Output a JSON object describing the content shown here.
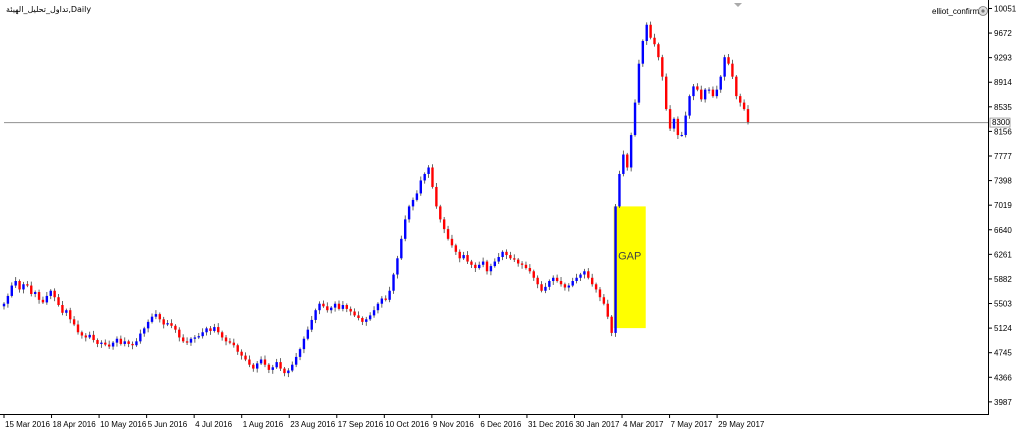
{
  "window": {
    "title": "تداول_تحليل_الهيئة,Daily",
    "indicator_label": "elliot_confirm",
    "indicator_icon": "gear-icon",
    "scroll_marker_icon": "triangle-down-icon"
  },
  "colors": {
    "bull": "#0000ff",
    "bear": "#ff0000",
    "wick": "#404040",
    "axis": "#000000",
    "hline": "#909090",
    "gap_fill": "#ffff00"
  },
  "chart_data": {
    "type": "candlestick",
    "title": "تداول_تحليل_الهيئة,Daily",
    "y_axis_ticks": [
      "10051",
      "9672",
      "9293",
      "8914",
      "8535",
      "8156",
      "7777",
      "7398",
      "7019",
      "6640",
      "6261",
      "5882",
      "5503",
      "5124",
      "4745",
      "4366",
      "3987"
    ],
    "ylim": [
      3800,
      10120
    ],
    "x_axis_ticks": [
      "15 Mar 2016",
      "18 Apr 2016",
      "10 May 2016",
      "5 Jun 2016",
      "4 Jul 2016",
      "1 Aug 2016",
      "23 Aug 2016",
      "17 Sep 2016",
      "10 Oct 2016",
      "9 Nov 2016",
      "6 Dec 2016",
      "31 Dec 2016",
      "30 Jan 2017",
      "4 Mar 2017",
      "7 May 2017",
      "29 May 2017"
    ],
    "horizontal_line": {
      "value": 8300,
      "label": "8300"
    },
    "annotation": {
      "label": "GAP",
      "from_index": 156,
      "to_index": 165,
      "low": 5124,
      "high": 7000
    },
    "grid": false,
    "closes": [
      5500,
      5620,
      5780,
      5850,
      5720,
      5800,
      5780,
      5650,
      5680,
      5560,
      5520,
      5620,
      5700,
      5600,
      5480,
      5360,
      5400,
      5260,
      5180,
      5060,
      5010,
      4980,
      5020,
      4940,
      4880,
      4900,
      4870,
      4840,
      4900,
      4960,
      4880,
      4920,
      4880,
      4860,
      4920,
      5040,
      5120,
      5220,
      5300,
      5340,
      5260,
      5180,
      5200,
      5160,
      5100,
      4980,
      4920,
      4900,
      4960,
      4980,
      5000,
      5060,
      5120,
      5080,
      5140,
      5060,
      4980,
      4920,
      4900,
      4860,
      4760,
      4700,
      4640,
      4560,
      4500,
      4580,
      4640,
      4560,
      4480,
      4520,
      4600,
      4500,
      4430,
      4470,
      4560,
      4680,
      4800,
      4960,
      5100,
      5250,
      5400,
      5500,
      5460,
      5400,
      5440,
      5500,
      5420,
      5480,
      5420,
      5380,
      5320,
      5280,
      5220,
      5260,
      5320,
      5400,
      5500,
      5580,
      5560,
      5700,
      5950,
      6200,
      6500,
      6800,
      7000,
      7100,
      7200,
      7400,
      7500,
      7600,
      7300,
      7000,
      6800,
      6650,
      6500,
      6400,
      6300,
      6200,
      6250,
      6150,
      6100,
      6050,
      6100,
      6150,
      6000,
      6080,
      6150,
      6220,
      6300,
      6250,
      6200,
      6180,
      6120,
      6100,
      6050,
      6000,
      5900,
      5800,
      5700,
      5760,
      5850,
      5900,
      5850,
      5800,
      5750,
      5780,
      5850,
      5900,
      5950,
      6000,
      5900,
      5800,
      5720,
      5600,
      5500,
      5300,
      5050,
      7000,
      7500,
      7800,
      7600,
      8100,
      8600,
      9200,
      9550,
      9800,
      9600,
      9500,
      9300,
      9000,
      8500,
      8200,
      8350,
      8100,
      8100,
      8400,
      8700,
      8850,
      8800,
      8650,
      8800,
      8800,
      8700,
      8800,
      9000,
      9300,
      9200,
      9000,
      8700,
      8600,
      8500,
      8300
    ]
  }
}
